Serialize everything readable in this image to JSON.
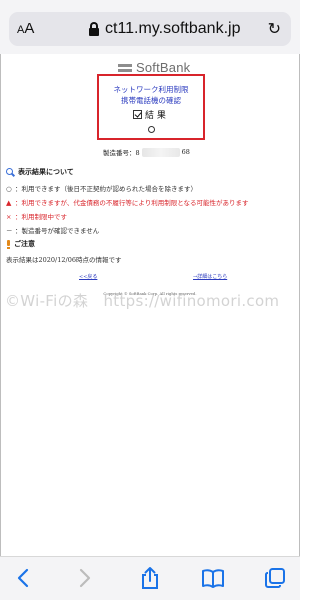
{
  "browser": {
    "text_size_label": "AA",
    "url": "ct11.my.softbank.jp",
    "reload_glyph": "↻"
  },
  "page": {
    "logo_text": "SoftBank",
    "result_box": {
      "title_line1": "ネットワーク利用制限",
      "title_line2": "携帯電話機の確認",
      "result_label": "結 果",
      "result_symbol": "○"
    },
    "serial_label": "製造番号：8",
    "serial_suffix": "68",
    "display_results_heading": "表示結果について",
    "legend": [
      {
        "symbol": "○",
        "text": "：利用できます（後日不正契約が認められた場合を除きます）",
        "color": "#333333"
      },
      {
        "symbol": "▲",
        "text": "：利用できますが、代金債務の不履行等により利用制限となる可能性があります",
        "color": "#d9262c"
      },
      {
        "symbol": "×",
        "text": "：利用制限中です",
        "color": "#d9262c"
      },
      {
        "symbol": "－",
        "text": "：製造番号が確認できません",
        "color": "#333333"
      }
    ],
    "notice_heading": "ご注意",
    "notice_text": "表示結果は2020/12/06時点の情報です",
    "back_link": "<<戻る",
    "details_link": "→詳細はこちら",
    "copyright": "Copyright © SoftBank Corp. All rights reserved."
  },
  "watermark": "©Wi-Fiの森　https://wifinomori.com",
  "toolbar": {
    "back": "back",
    "forward": "forward",
    "share": "share",
    "bookmarks": "bookmarks",
    "tabs": "tabs"
  },
  "colors": {
    "highlight_border": "#d8242b",
    "link_blue": "#2b3bbf",
    "safari_blue": "#1a73e8"
  }
}
